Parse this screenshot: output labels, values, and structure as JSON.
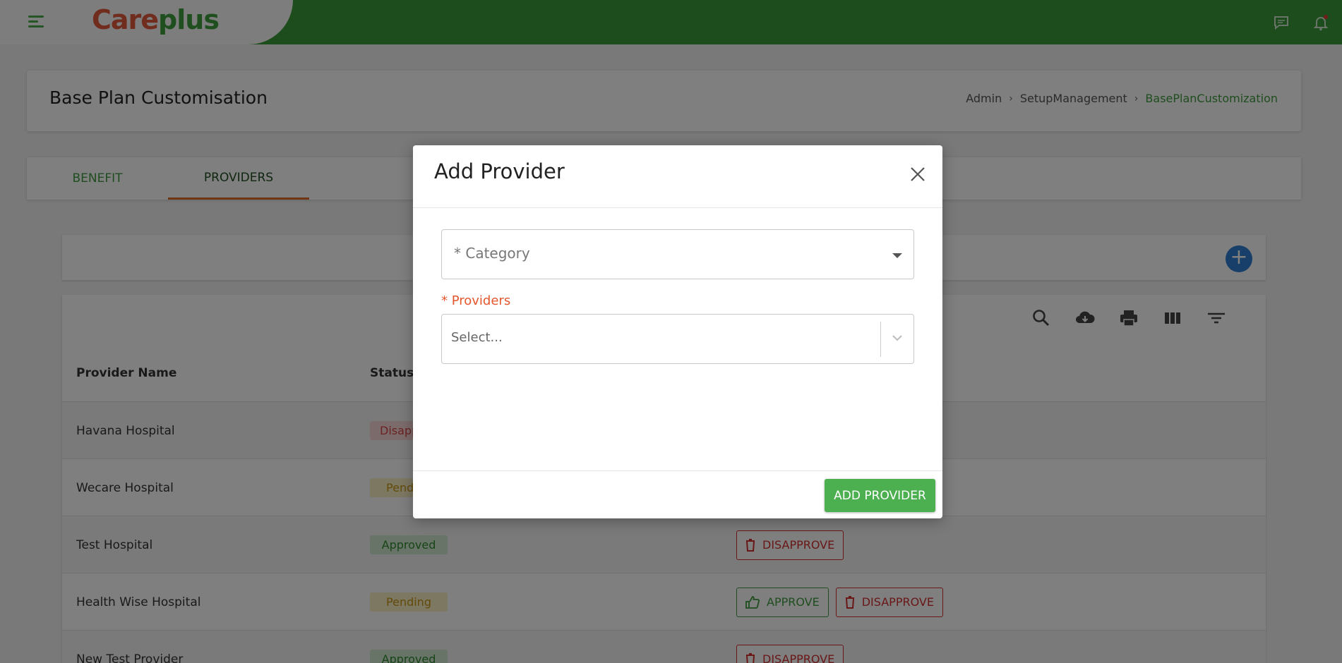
{
  "app": {
    "logo_part1": "Care",
    "logo_part2": "plus",
    "brand_color": "#3a9a3a",
    "accent_color": "#e06a24"
  },
  "header": {
    "title": "Base Plan Customisation",
    "breadcrumb": [
      "Admin",
      "SetupManagement",
      "BasePlanCustomization"
    ]
  },
  "tabs": [
    {
      "label": "BENEFIT"
    },
    {
      "label": "PROVIDERS"
    }
  ],
  "table": {
    "columns": [
      "Provider Name",
      "Status"
    ],
    "rows": [
      {
        "name": "Havana Hospital",
        "status": "Disapproved",
        "actions": []
      },
      {
        "name": "Wecare Hospital",
        "status": "Pending",
        "actions": []
      },
      {
        "name": "Test Hospital",
        "status": "Approved",
        "actions": [
          "DISAPPROVE"
        ]
      },
      {
        "name": "Health Wise Hospital",
        "status": "Pending",
        "actions": [
          "APPROVE",
          "DISAPPROVE"
        ]
      },
      {
        "name": "New Test Provider",
        "status": "Approved",
        "actions": [
          "DISAPPROVE"
        ]
      }
    ]
  },
  "modal": {
    "title": "Add Provider",
    "category_placeholder": "* Category",
    "providers_label": "* Providers",
    "providers_placeholder": "Select...",
    "submit_label": "ADD PROVIDER"
  },
  "icons": [
    "menu-icon",
    "chat-icon",
    "bell-icon",
    "plus-icon",
    "search-icon",
    "cloud-download-icon",
    "print-icon",
    "columns-icon",
    "filter-icon",
    "close-icon",
    "chevron-down-icon",
    "thumbs-up-icon",
    "trash-icon"
  ]
}
